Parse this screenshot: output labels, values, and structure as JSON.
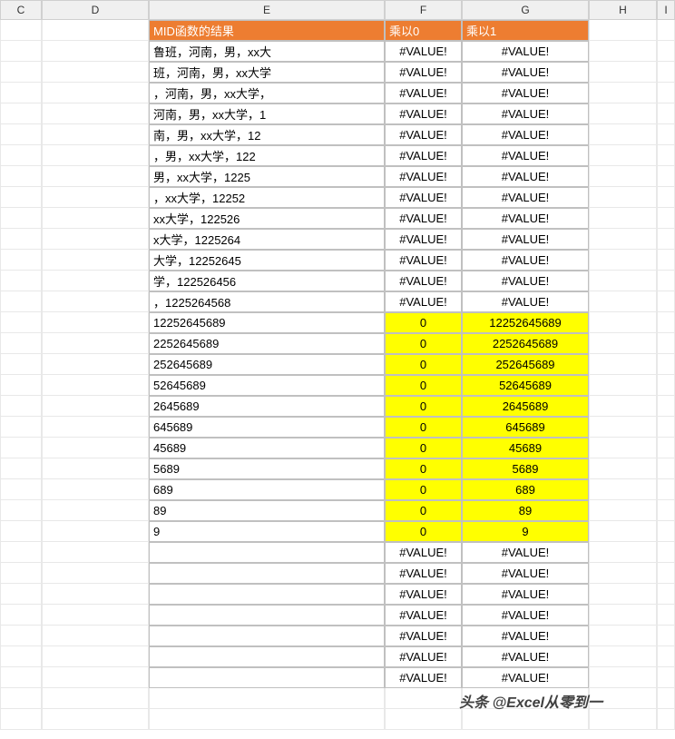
{
  "columns": {
    "c": "C",
    "d": "D",
    "e": "E",
    "f": "F",
    "g": "G",
    "h": "H",
    "i": "I"
  },
  "headers": {
    "e": "MID函数的结果",
    "f": "乘以0",
    "g": "乘以1"
  },
  "rows": [
    {
      "e": "鲁班，河南，男，xx大",
      "f": "#VALUE!",
      "g": "#VALUE!",
      "hl": false
    },
    {
      "e": "班，河南，男，xx大学",
      "f": "#VALUE!",
      "g": "#VALUE!",
      "hl": false
    },
    {
      "e": "，河南，男，xx大学，",
      "f": "#VALUE!",
      "g": "#VALUE!",
      "hl": false
    },
    {
      "e": "河南，男，xx大学，1",
      "f": "#VALUE!",
      "g": "#VALUE!",
      "hl": false
    },
    {
      "e": "南，男，xx大学，12",
      "f": "#VALUE!",
      "g": "#VALUE!",
      "hl": false
    },
    {
      "e": "，男，xx大学，122",
      "f": "#VALUE!",
      "g": "#VALUE!",
      "hl": false
    },
    {
      "e": "男，xx大学，1225",
      "f": "#VALUE!",
      "g": "#VALUE!",
      "hl": false
    },
    {
      "e": "，xx大学，12252",
      "f": "#VALUE!",
      "g": "#VALUE!",
      "hl": false
    },
    {
      "e": "xx大学，122526",
      "f": "#VALUE!",
      "g": "#VALUE!",
      "hl": false
    },
    {
      "e": "x大学，1225264",
      "f": "#VALUE!",
      "g": "#VALUE!",
      "hl": false
    },
    {
      "e": "大学，12252645",
      "f": "#VALUE!",
      "g": "#VALUE!",
      "hl": false
    },
    {
      "e": "学，122526456",
      "f": "#VALUE!",
      "g": "#VALUE!",
      "hl": false
    },
    {
      "e": "，1225264568",
      "f": "#VALUE!",
      "g": "#VALUE!",
      "hl": false
    },
    {
      "e": "12252645689",
      "f": "0",
      "g": "12252645689",
      "hl": true
    },
    {
      "e": "2252645689",
      "f": "0",
      "g": "2252645689",
      "hl": true
    },
    {
      "e": "252645689",
      "f": "0",
      "g": "252645689",
      "hl": true
    },
    {
      "e": "52645689",
      "f": "0",
      "g": "52645689",
      "hl": true
    },
    {
      "e": "2645689",
      "f": "0",
      "g": "2645689",
      "hl": true
    },
    {
      "e": "645689",
      "f": "0",
      "g": "645689",
      "hl": true
    },
    {
      "e": "45689",
      "f": "0",
      "g": "45689",
      "hl": true
    },
    {
      "e": "5689",
      "f": "0",
      "g": "5689",
      "hl": true
    },
    {
      "e": "689",
      "f": "0",
      "g": "689",
      "hl": true
    },
    {
      "e": "89",
      "f": "0",
      "g": "89",
      "hl": true
    },
    {
      "e": "9",
      "f": "0",
      "g": "9",
      "hl": true
    },
    {
      "e": "",
      "f": "#VALUE!",
      "g": "#VALUE!",
      "hl": false
    },
    {
      "e": "",
      "f": "#VALUE!",
      "g": "#VALUE!",
      "hl": false
    },
    {
      "e": "",
      "f": "#VALUE!",
      "g": "#VALUE!",
      "hl": false
    },
    {
      "e": "",
      "f": "#VALUE!",
      "g": "#VALUE!",
      "hl": false
    },
    {
      "e": "",
      "f": "#VALUE!",
      "g": "#VALUE!",
      "hl": false
    },
    {
      "e": "",
      "f": "#VALUE!",
      "g": "#VALUE!",
      "hl": false
    },
    {
      "e": "",
      "f": "#VALUE!",
      "g": "#VALUE!",
      "hl": false
    }
  ],
  "watermark": "头条 @Excel从零到一"
}
